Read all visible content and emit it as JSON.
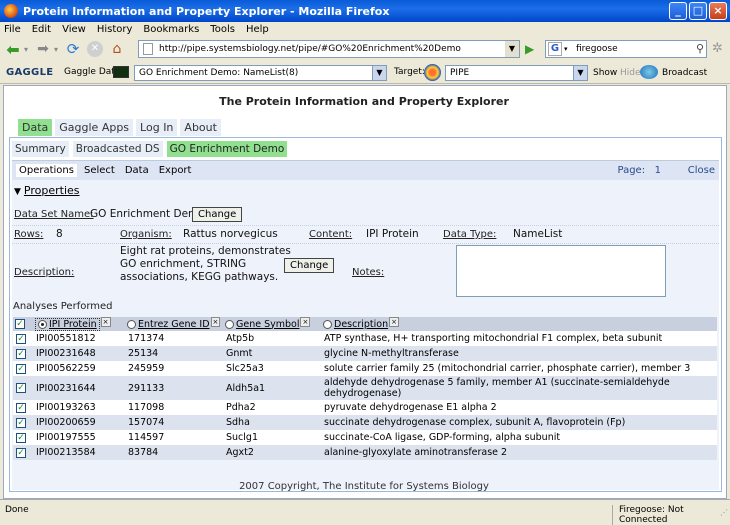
{
  "window": {
    "title": "Protein Information and Property Explorer - Mozilla Firefox"
  },
  "menu": [
    "File",
    "Edit",
    "View",
    "History",
    "Bookmarks",
    "Tools",
    "Help"
  ],
  "nav": {
    "url": "http://pipe.systemsbiology.net/pipe/#GO%20Enrichment%20Demo",
    "search_engine": "G",
    "search_value": "firegoose"
  },
  "gaggle": {
    "logo": "GAGGLE",
    "data_label": "Gaggle Data:",
    "data_value": "GO Enrichment Demo: NameList(8)",
    "target_label": "Target:",
    "target_value": "PIPE",
    "show_label": "Show",
    "hide_label": "Hide",
    "broadcast_label": "Broadcast"
  },
  "page": {
    "title": "The Protein Information and Property Explorer",
    "main_tabs": [
      "Data",
      "Gaggle Apps",
      "Log In",
      "About"
    ],
    "sub_tabs": [
      "Summary",
      "Broadcasted DS",
      "GO Enrichment Demo"
    ],
    "ops_tabs": [
      "Operations",
      "Select",
      "Data",
      "Export"
    ],
    "page_label": "Page:",
    "page_number": "1",
    "close_label": "Close",
    "properties_label": "Properties",
    "dataset_name_label": "Data Set Name:",
    "dataset_name_value": "GO Enrichment Demo",
    "change_label": "Change",
    "rows_label": "Rows:",
    "rows_value": "8",
    "organism_label": "Organism:",
    "organism_value": "Rattus norvegicus",
    "content_label": "Content:",
    "content_value": "IPI Protein",
    "datatype_label": "Data Type:",
    "datatype_value": "NameList",
    "description_label": "Description:",
    "description_lines": [
      "Eight rat proteins, demonstrates",
      "GO enrichment, STRING",
      "associations, KEGG pathways."
    ],
    "notes_label": "Notes:",
    "analyses_label": "Analyses Performed",
    "footer": "2007 Copyright, The Institute for Systems Biology"
  },
  "table": {
    "columns": [
      "IPI Protein",
      "Entrez Gene ID",
      "Gene Symbol",
      "Description"
    ],
    "rows": [
      [
        "IPI00551812",
        "171374",
        "Atp5b",
        "ATP synthase, H+ transporting mitochondrial F1 complex, beta subunit"
      ],
      [
        "IPI00231648",
        "25134",
        "Gnmt",
        "glycine N-methyltransferase"
      ],
      [
        "IPI00562259",
        "245959",
        "Slc25a3",
        "solute carrier family 25 (mitochondrial carrier, phosphate carrier), member 3"
      ],
      [
        "IPI00231644",
        "291133",
        "Aldh5a1",
        "aldehyde dehydrogenase 5 family, member A1 (succinate-semialdehyde dehydrogenase)"
      ],
      [
        "IPI00193263",
        "117098",
        "Pdha2",
        "pyruvate dehydrogenase E1 alpha 2"
      ],
      [
        "IPI00200659",
        "157074",
        "Sdha",
        "succinate dehydrogenase complex, subunit A, flavoprotein (Fp)"
      ],
      [
        "IPI00197555",
        "114597",
        "Suclg1",
        "succinate-CoA ligase, GDP-forming, alpha subunit"
      ],
      [
        "IPI00213584",
        "83784",
        "Agxt2",
        "alanine-glyoxylate aminotransferase 2"
      ]
    ]
  },
  "status": {
    "left": "Done",
    "right": "Firegoose: Not Connected"
  }
}
